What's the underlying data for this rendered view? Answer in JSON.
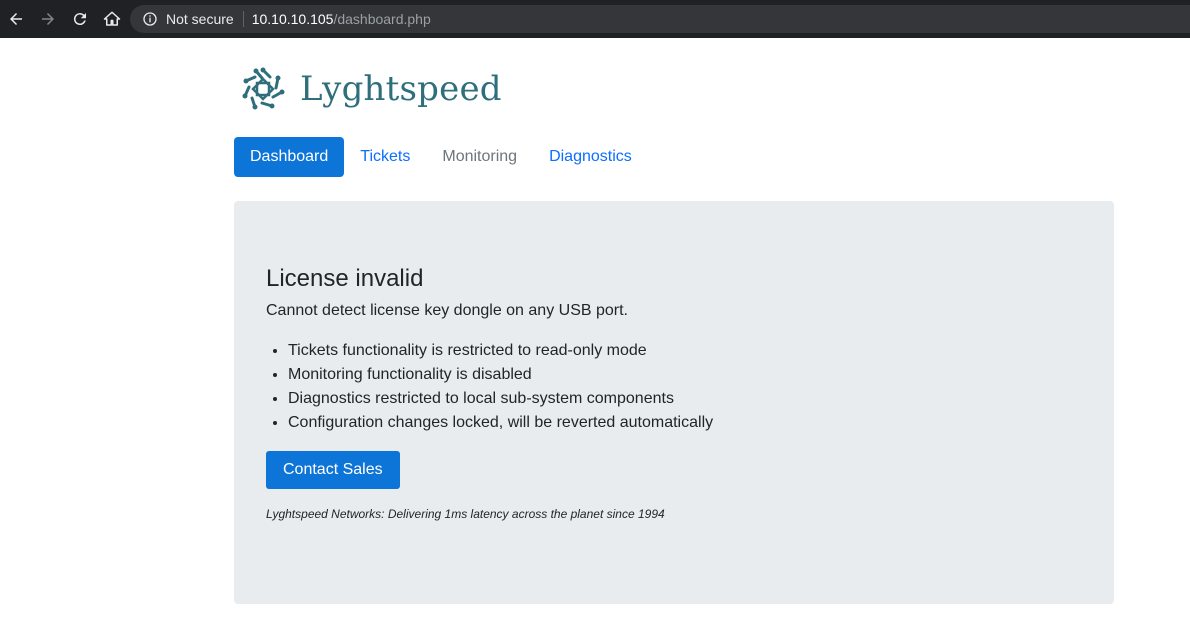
{
  "browser": {
    "security_label": "Not secure",
    "url_host": "10.10.10.105",
    "url_path": "/dashboard.php"
  },
  "brand": {
    "name": "Lyghtspeed"
  },
  "nav": {
    "tabs": [
      {
        "label": "Dashboard",
        "state": "active"
      },
      {
        "label": "Tickets",
        "state": "link"
      },
      {
        "label": "Monitoring",
        "state": "disabled"
      },
      {
        "label": "Diagnostics",
        "state": "link"
      }
    ]
  },
  "main": {
    "title": "License invalid",
    "lead": "Cannot detect license key dongle on any USB port.",
    "items": [
      "Tickets functionality is restricted to read-only mode",
      "Monitoring functionality is disabled",
      "Diagnostics restricted to local sub-system components",
      "Configuration changes locked, will be reverted automatically"
    ],
    "button_label": "Contact Sales",
    "footer": "Lyghtspeed Networks: Delivering 1ms latency across the planet since 1994"
  },
  "colors": {
    "accent": "#0d74d8",
    "brand": "#2f6f7c",
    "panel": "#e9ecef"
  }
}
